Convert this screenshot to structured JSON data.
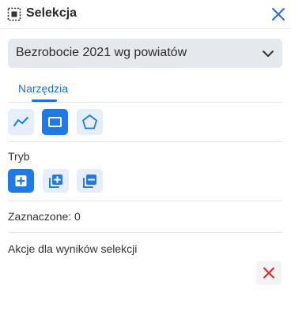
{
  "header": {
    "title": "Selekcja",
    "icon": "selection-icon",
    "close_icon": "close-icon"
  },
  "layer_select": {
    "value": "Bezrobocie 2021 wg powiatów",
    "icon": "chevron-down-icon"
  },
  "tabs": [
    {
      "label": "Narzędzia",
      "selected": true
    }
  ],
  "tools": [
    {
      "name": "polyline-tool",
      "icon": "polyline-icon",
      "active": false
    },
    {
      "name": "rectangle-tool",
      "icon": "rectangle-icon",
      "active": true
    },
    {
      "name": "polygon-tool",
      "icon": "pentagon-icon",
      "active": false
    }
  ],
  "mode": {
    "label": "Tryb",
    "options": [
      {
        "name": "new-selection",
        "icon": "plus-square-icon",
        "active": true
      },
      {
        "name": "add-to-selection",
        "icon": "layers-plus-icon",
        "active": false
      },
      {
        "name": "remove-from-selection",
        "icon": "layers-minus-icon",
        "active": false
      }
    ]
  },
  "selected_count": "Zaznaczone: 0",
  "actions": {
    "label": "Akcje dla wyników selekcji",
    "clear_icon": "clear-x-icon"
  },
  "colors": {
    "accent": "#1f7ae6",
    "inactive_button": "#e6eefb",
    "select_background": "#e5e8ed",
    "danger": "#e0262b"
  }
}
